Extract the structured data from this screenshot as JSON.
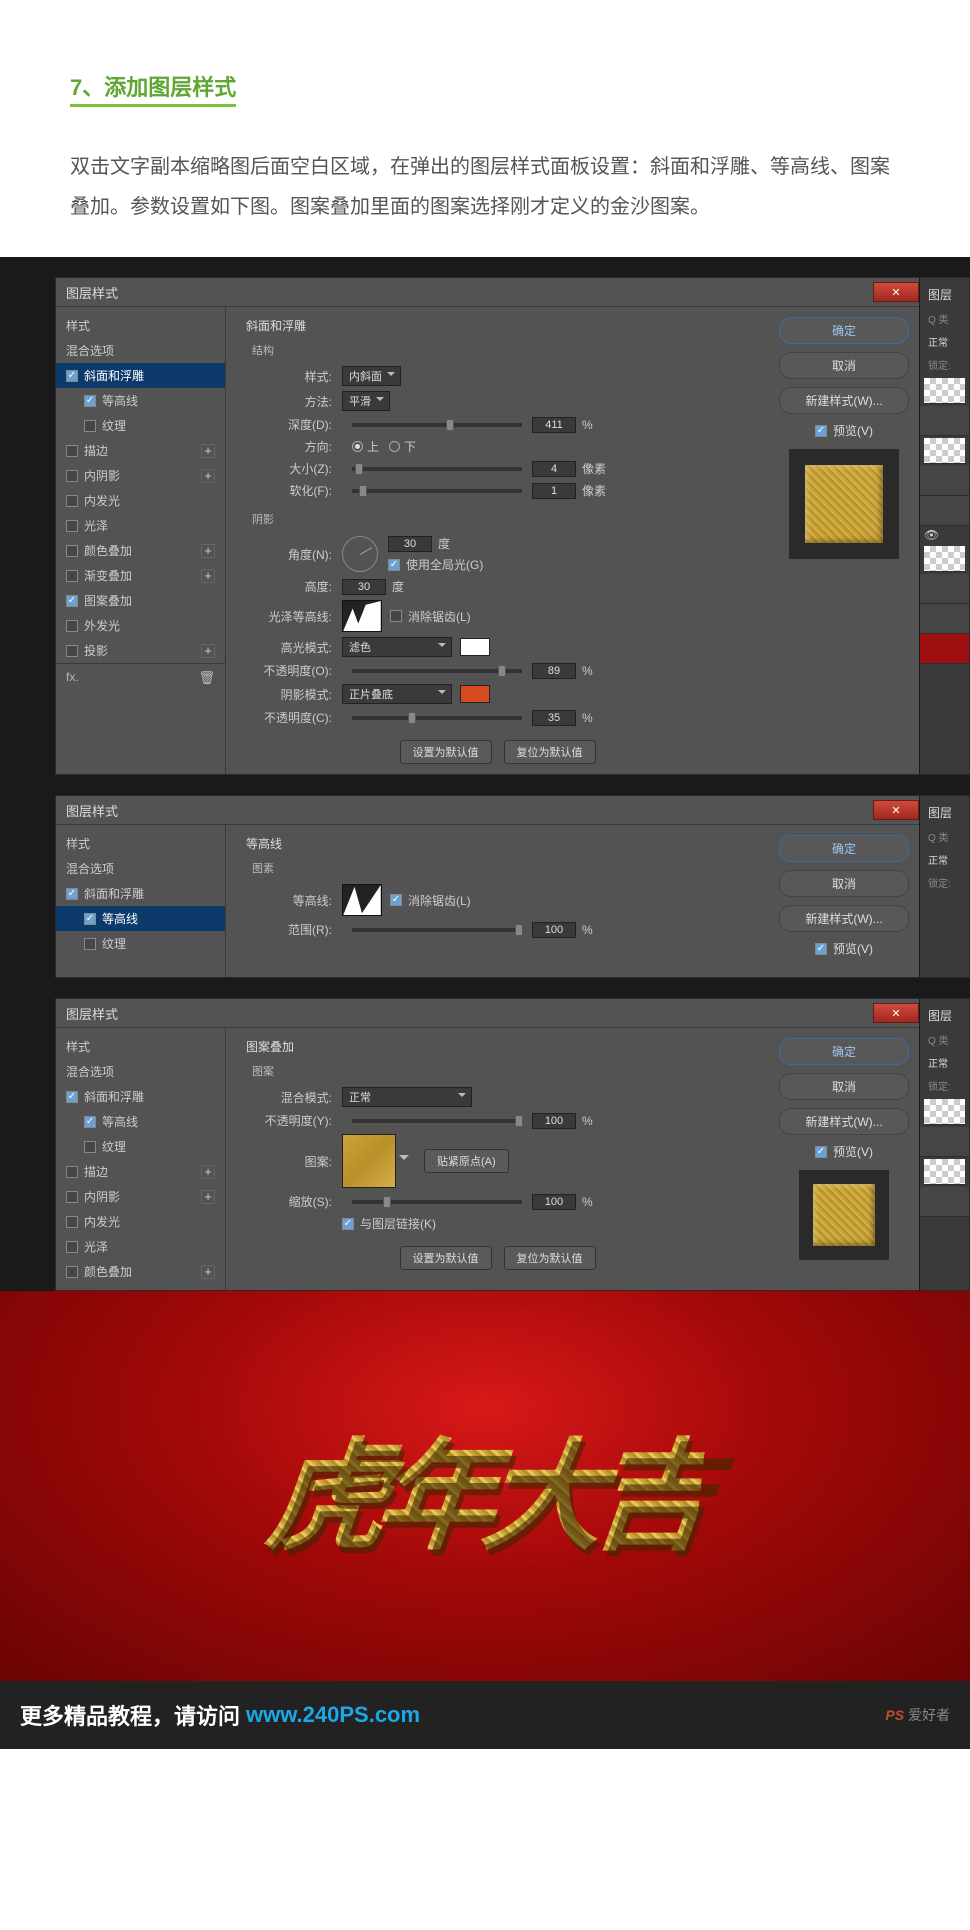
{
  "step": {
    "num": "7、",
    "title": "添加图层样式"
  },
  "desc": "双击文字副本缩略图后面空白区域，在弹出的图层样式面板设置：斜面和浮雕、等高线、图案叠加。参数设置如下图。图案叠加里面的图案选择刚才定义的金沙图案。",
  "dlg_title": "图层样式",
  "layers_tab": "图层",
  "normal_mode": "正常",
  "lock_label": "锁定:",
  "search_prefix": "Q 类",
  "buttons": {
    "ok": "确定",
    "cancel": "取消",
    "newstyle": "新建样式(W)...",
    "preview": "预览(V)",
    "default": "设置为默认值",
    "reset": "复位为默认值",
    "snap": "贴紧原点(A)"
  },
  "styles": {
    "style": "样式",
    "blend": "混合选项",
    "bevel": "斜面和浮雕",
    "contour": "等高线",
    "texture": "纹理",
    "stroke": "描边",
    "inner_shadow": "内阴影",
    "inner_glow": "内发光",
    "satin": "光泽",
    "color_ov": "颜色叠加",
    "grad_ov": "渐变叠加",
    "pat_ov": "图案叠加",
    "outer_glow": "外发光",
    "drop_shadow": "投影"
  },
  "footer_fx": "fx.",
  "bevel": {
    "title": "斜面和浮雕",
    "structure": "结构",
    "shading": "阴影",
    "style_lbl": "样式:",
    "style_v": "内斜面",
    "method_lbl": "方法:",
    "method_v": "平滑",
    "depth_lbl": "深度(D):",
    "depth_v": "411",
    "pct": "%",
    "dir_lbl": "方向:",
    "up": "上",
    "down": "下",
    "size_lbl": "大小(Z):",
    "size_v": "4",
    "px": "像素",
    "soften_lbl": "软化(F):",
    "soften_v": "1",
    "angle_lbl": "角度(N):",
    "angle_v": "30",
    "deg": "度",
    "global": "使用全局光(G)",
    "alt_lbl": "高度:",
    "alt_v": "30",
    "gloss_lbl": "光泽等高线:",
    "anti": "消除锯齿(L)",
    "hl_mode_lbl": "高光模式:",
    "hl_mode_v": "滤色",
    "hl_op_lbl": "不透明度(O):",
    "hl_op_v": "89",
    "sh_mode_lbl": "阴影模式:",
    "sh_mode_v": "正片叠底",
    "sh_op_lbl": "不透明度(C):",
    "sh_op_v": "35"
  },
  "contour_panel": {
    "title": "等高线",
    "elements": "图素",
    "contour_lbl": "等高线:",
    "anti": "消除锯齿(L)",
    "range_lbl": "范围(R):",
    "range_v": "100",
    "pct": "%"
  },
  "pattern_panel": {
    "title": "图案叠加",
    "pattern": "图案",
    "blend_lbl": "混合模式:",
    "blend_v": "正常",
    "opacity_lbl": "不透明度(Y):",
    "opacity_v": "100",
    "pct": "%",
    "pattern_lbl": "图案:",
    "scale_lbl": "缩放(S):",
    "scale_v": "100",
    "link": "与图层链接(K)"
  },
  "result_text": "虎年大吉",
  "footer": {
    "text": "更多精品教程，请访问",
    "link": "www.240PS.com",
    "logo1": "PS",
    "logo2": "爱好者"
  }
}
